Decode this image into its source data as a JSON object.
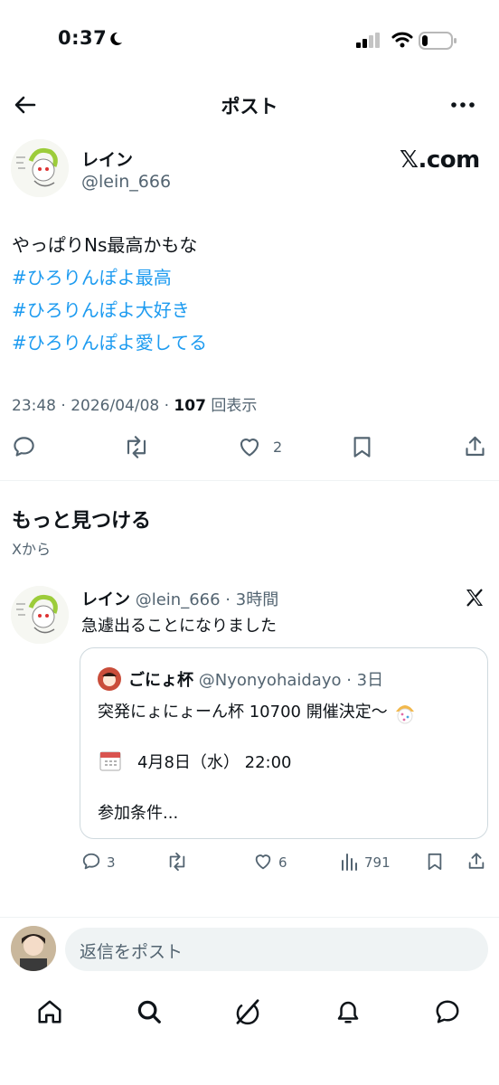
{
  "status_bar": {
    "time": "0:37",
    "battery_level": 0.2
  },
  "header": {
    "title": "ポスト"
  },
  "post": {
    "author_name": "レイン",
    "author_handle": "@lein_666",
    "source_label": "𝕏.com",
    "lines": [
      "やっぱりNs最高かもな",
      "#ひろりんぽよ最高",
      "#ひろりんぽよ大好き",
      "#ひろりんぽよ愛してる"
    ],
    "time": "23:48",
    "date": "2026/04/08",
    "views_count": "107",
    "views_label": "回表示",
    "like_count": "2"
  },
  "discover": {
    "title": "もっと見つける",
    "subtitle": "Xから"
  },
  "recommended": {
    "author_name": "レイン",
    "author_handle": "@lein_666",
    "age": "3時間",
    "text": "急遽出ることになりました",
    "quote": {
      "author_name": "ごにょ杯",
      "author_handle": "@Nyonyohaidayo",
      "age": "3日",
      "line1": "突発にょにょーん杯  10700  開催決定〜",
      "line2": "4月8日（水）  22:00",
      "line3": "参加条件..."
    },
    "reply_count": "3",
    "like_count": "6",
    "views_count": "791"
  },
  "composer": {
    "placeholder": "返信をポスト"
  },
  "colors": {
    "link": "#1d9bf0",
    "muted": "#536471",
    "text": "#0f1419"
  }
}
